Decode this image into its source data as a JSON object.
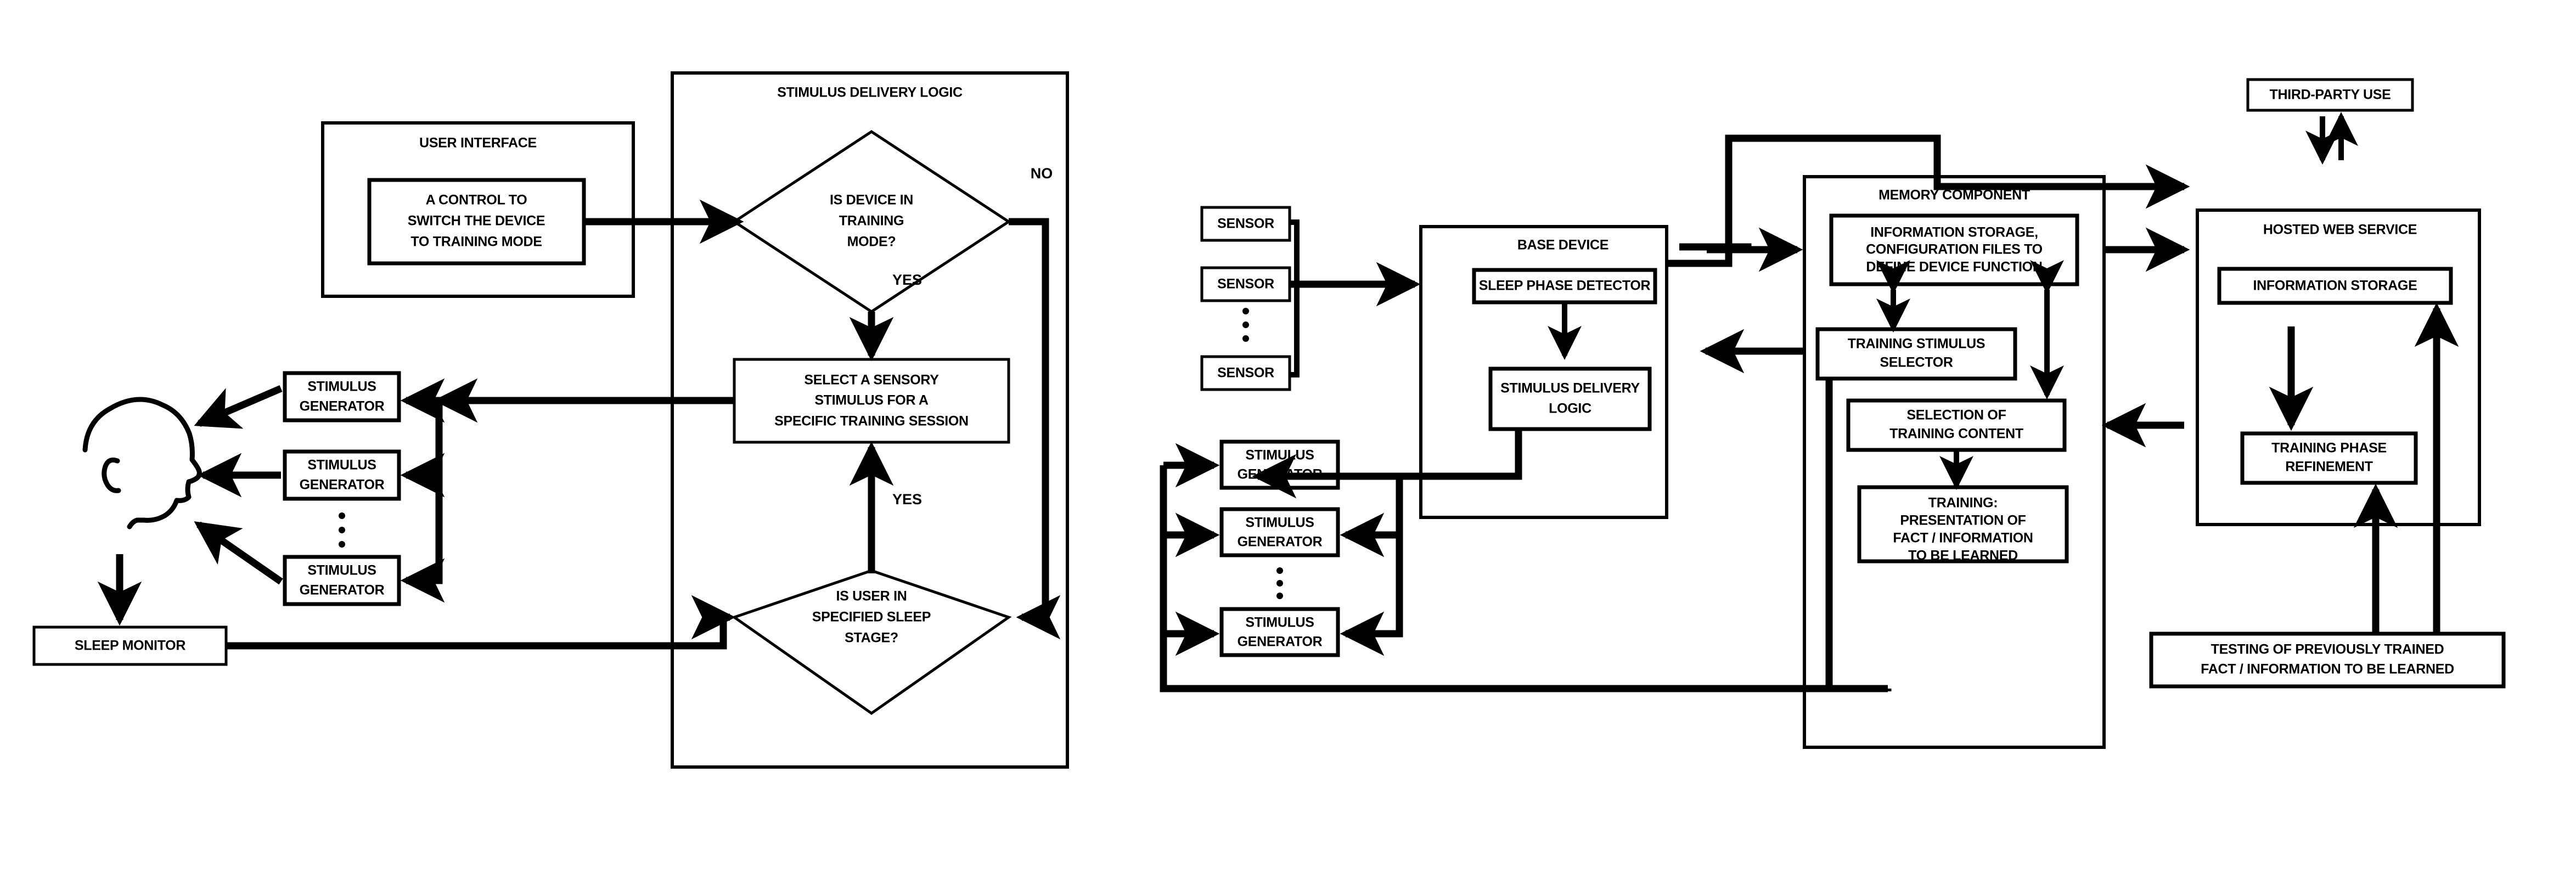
{
  "figure": {
    "type": "patent-block-diagram",
    "panels": {
      "user_interface": "USER INTERFACE",
      "stimulus_delivery_logic": "STIMULUS DELIVERY LOGIC",
      "base_device": "BASE DEVICE",
      "memory_component": "MEMORY COMPONENT",
      "hosted_web_service": "HOSTED WEB SERVICE"
    }
  },
  "left_diagram": {
    "user_interface": {
      "title": "USER INTERFACE",
      "control_box": [
        "A CONTROL TO",
        "SWITCH THE DEVICE",
        "TO TRAINING MODE"
      ]
    },
    "stimulus_delivery_logic": {
      "title": "STIMULUS DELIVERY LOGIC",
      "decision_1": [
        "IS DEVICE IN",
        "TRAINING",
        "MODE?"
      ],
      "decision_1_no": "NO",
      "decision_1_yes": "YES",
      "process": [
        "SELECT A SENSORY",
        "STIMULUS FOR A",
        "SPECIFIC TRAINING SESSION"
      ],
      "decision_2": [
        "IS USER IN",
        "SPECIFIED SLEEP",
        "STAGE?"
      ],
      "decision_2_yes": "YES"
    },
    "stimulus_generators": [
      [
        "STIMULUS",
        "GENERATOR"
      ],
      [
        "STIMULUS",
        "GENERATOR"
      ],
      [
        "STIMULUS",
        "GENERATOR"
      ]
    ],
    "ellipsis_label": "vertical-ellipsis",
    "sleep_monitor": "SLEEP MONITOR",
    "subject": "sleeping-head-profile"
  },
  "right_diagram": {
    "sensors": [
      "SENSOR",
      "SENSOR",
      "SENSOR"
    ],
    "sensor_ellipsis": "vertical-ellipsis",
    "base_device": {
      "title": "BASE DEVICE",
      "sleep_phase_detector": "SLEEP PHASE DETECTOR",
      "stimulus_delivery_logic": [
        "STIMULUS DELIVERY",
        "LOGIC"
      ]
    },
    "stimulus_generators": [
      [
        "STIMULUS",
        "GENERATOR"
      ],
      [
        "STIMULUS",
        "GENERATOR"
      ],
      [
        "STIMULUS",
        "GENERATOR"
      ]
    ],
    "generator_ellipsis": "vertical-ellipsis",
    "memory_component": {
      "title": "MEMORY COMPONENT",
      "information_storage": [
        "INFORMATION STORAGE,",
        "CONFIGURATION FILES TO",
        "DEFINE DEVICE FUNCTION"
      ],
      "training_stimulus_selector": [
        "TRAINING STIMULUS",
        "SELECTOR"
      ],
      "selection_of_training_content": [
        "SELECTION OF",
        "TRAINING CONTENT"
      ],
      "training_presentation": [
        "TRAINING:",
        "PRESENTATION OF",
        "FACT / INFORMATION",
        "TO BE LEARNED"
      ]
    },
    "third_party_use": "THIRD-PARTY USE",
    "hosted_web_service": {
      "title": "HOSTED WEB SERVICE",
      "information_storage": "INFORMATION STORAGE",
      "training_phase_refinement": [
        "TRAINING PHASE",
        "REFINEMENT"
      ]
    },
    "testing_box": [
      "TESTING OF PREVIOUSLY TRAINED",
      "FACT / INFORMATION TO BE LEARNED"
    ]
  },
  "colors": {
    "stroke": "#000000",
    "background": "#ffffff"
  }
}
